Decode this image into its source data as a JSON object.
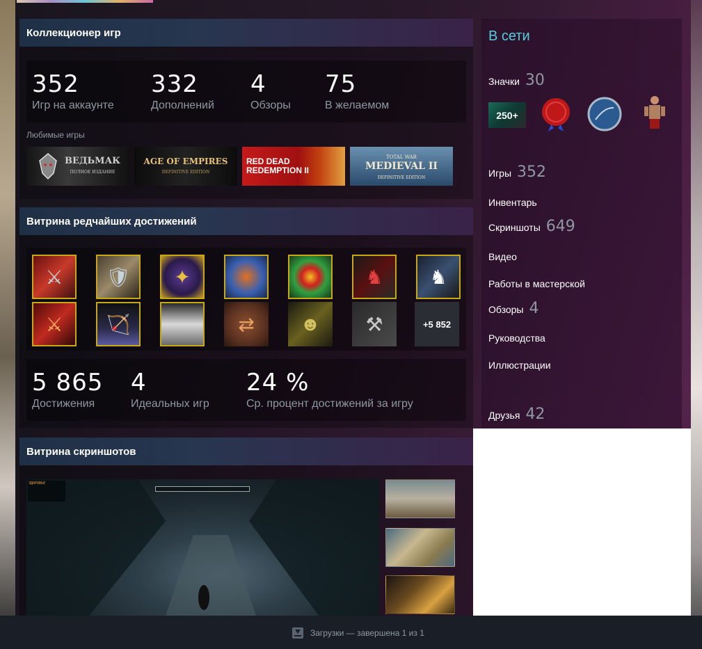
{
  "game_collector": {
    "title": "Коллекционер игр",
    "stats": [
      {
        "value": "352",
        "label": "Игр на аккаунте"
      },
      {
        "value": "332",
        "label": "Дополнений"
      },
      {
        "value": "4",
        "label": "Обзоры"
      },
      {
        "value": "75",
        "label": "В желаемом"
      }
    ],
    "favorites_label": "Любимые игры",
    "favorites": [
      {
        "name": "ВЕДЬМАК",
        "sub": "ПОЛНОЕ ИЗДАНИЕ"
      },
      {
        "name": "AGE OF EMPIRES",
        "sub": "DEFINITIVE EDITION"
      },
      {
        "name": "RED DEAD REDEMPTION II",
        "sub": ""
      },
      {
        "name": "MEDIEVAL II",
        "sub": "DEFINITIVE EDITION",
        "top": "TOTAL WAR"
      }
    ]
  },
  "rare_achievements": {
    "title": "Витрина редчайших достижений",
    "more_label": "+5 852",
    "icons": [
      "soldier-icon",
      "warrior-icon",
      "emblem-icon",
      "shield-icon",
      "round-shield-icon",
      "horseman-icon",
      "knight-icon",
      "legion-icon",
      "archer-icon",
      "arches-icon",
      "trade-icon",
      "ogre-icon",
      "dagger-shield-icon"
    ],
    "stats": [
      {
        "value": "5 865",
        "label": "Достижения"
      },
      {
        "value": "4",
        "label": "Идеальных игр"
      },
      {
        "value": "24 %",
        "label": "Ср. процент достижений за игру"
      }
    ]
  },
  "screenshots": {
    "title": "Витрина скриншотов",
    "hud": "ЗДОРОВЬЕ",
    "thumbs": [
      "desert-thumb",
      "map-thumb",
      "cloak-thumb"
    ]
  },
  "sidebar": {
    "status": "В сети",
    "badges_label": "Значки",
    "badges_count": "30",
    "badge_250": "250+",
    "links": [
      {
        "label": "Игры",
        "count": "352"
      },
      {
        "label": "Инвентарь",
        "count": ""
      },
      {
        "label": "Скриншоты",
        "count": "649"
      },
      {
        "label": "Видео",
        "count": ""
      },
      {
        "label": "Работы в мастерской",
        "count": ""
      },
      {
        "label": "Обзоры",
        "count": "4"
      },
      {
        "label": "Руководства",
        "count": ""
      },
      {
        "label": "Иллюстрации",
        "count": ""
      }
    ],
    "friends_label": "Друзья",
    "friends_count": "42"
  },
  "downloads": {
    "status": "Загрузки — завершена 1 из 1"
  }
}
